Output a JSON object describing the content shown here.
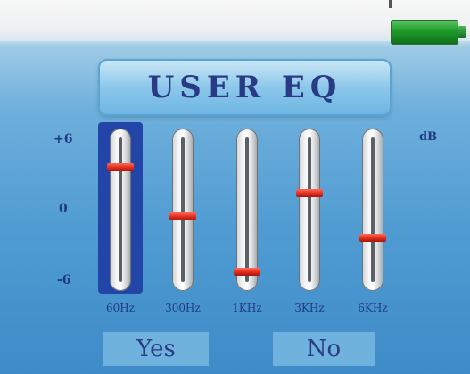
{
  "header": {
    "battery_icon": "battery-full-icon",
    "battery_color": "#1e9a2a"
  },
  "eq": {
    "title": "USER EQ",
    "scale": {
      "top": "+6",
      "mid": "0",
      "bottom": "-6",
      "unit": "dB"
    },
    "selected_band_index": 0,
    "bands": [
      {
        "label": "60Hz",
        "gain_fraction": 0.8
      },
      {
        "label": "300Hz",
        "gain_fraction": 0.45
      },
      {
        "label": "1KHz",
        "gain_fraction": 0.06
      },
      {
        "label": "3KHz",
        "gain_fraction": 0.62
      },
      {
        "label": "6KHz",
        "gain_fraction": 0.3
      }
    ]
  },
  "actions": {
    "yes_label": "Yes",
    "no_label": "No"
  },
  "colors": {
    "text": "#1e3a80",
    "knob": "#e02a1c",
    "selection": "#2345a8"
  }
}
